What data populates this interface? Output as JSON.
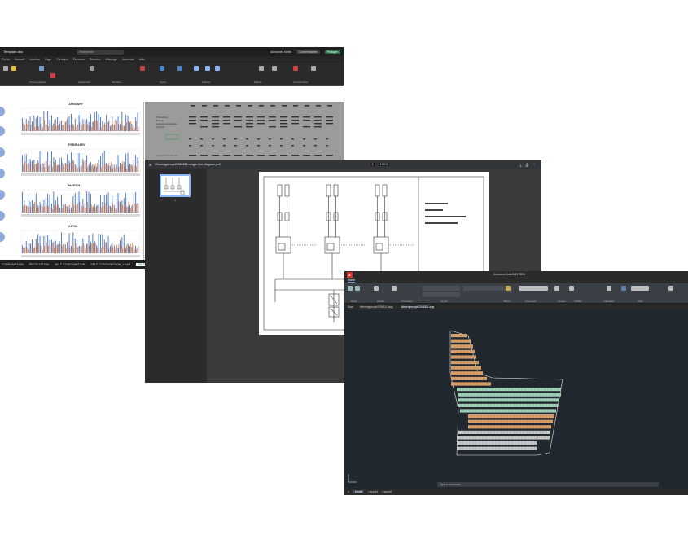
{
  "excel": {
    "doc_title": "Template.xlsx",
    "search": "Rechercher",
    "user": "Alexander Smith",
    "comments_label": "Commentaires",
    "share_label": "Partager",
    "menu": [
      "Fichier",
      "Accueil",
      "Insertion",
      "Page",
      "Formules",
      "Données",
      "Révision",
      "Affichage",
      "Automate",
      "Aide"
    ],
    "ribbon_groups": [
      "Presse-papiers",
      "Police",
      "Alignement",
      "Nombre",
      "Styles",
      "Cellules",
      "Édition",
      "Compléments"
    ],
    "months": [
      "JANUARY",
      "FEBRUARY",
      "MARCH",
      "APRIL"
    ],
    "sheet_tabs": [
      "CONSUMPTION",
      "PRODUCTION",
      "SELF-CONSUMPTION",
      "SELF-CONSUMPTION_YEAR",
      "SELF-CONSUMPTION"
    ],
    "grid_labels": [
      "Production",
      "Besoin",
      "Autoconsommation",
      "Surplus",
      "Quantité Production"
    ]
  },
  "pdf": {
    "title": "Wenedgeprojet2034821-single-line-diagram.pdf",
    "page": "1",
    "zoom": "100%",
    "thumb_page": "1"
  },
  "cad": {
    "window_title": "Autodesk AutoCAD 2024",
    "tabs": [
      "Home",
      "Insert",
      "Annotate",
      "Parametric",
      "View",
      "Manage",
      "Output",
      "Add-ins",
      "Collaborate",
      "Express Tools"
    ],
    "ribbon_groups": [
      "Draw",
      "Modify",
      "Annotation",
      "Layers",
      "Block",
      "Properties",
      "Groups",
      "Utilities",
      "Clipboard",
      "View"
    ],
    "doc_tabs": [
      "Start",
      "Wenedgeprojet2034821.dwg",
      "Wenedgeprojet2034821.dwg"
    ],
    "status_tabs": [
      "Model",
      "Layout1",
      "Layout2"
    ],
    "command_placeholder": "Type a command"
  }
}
